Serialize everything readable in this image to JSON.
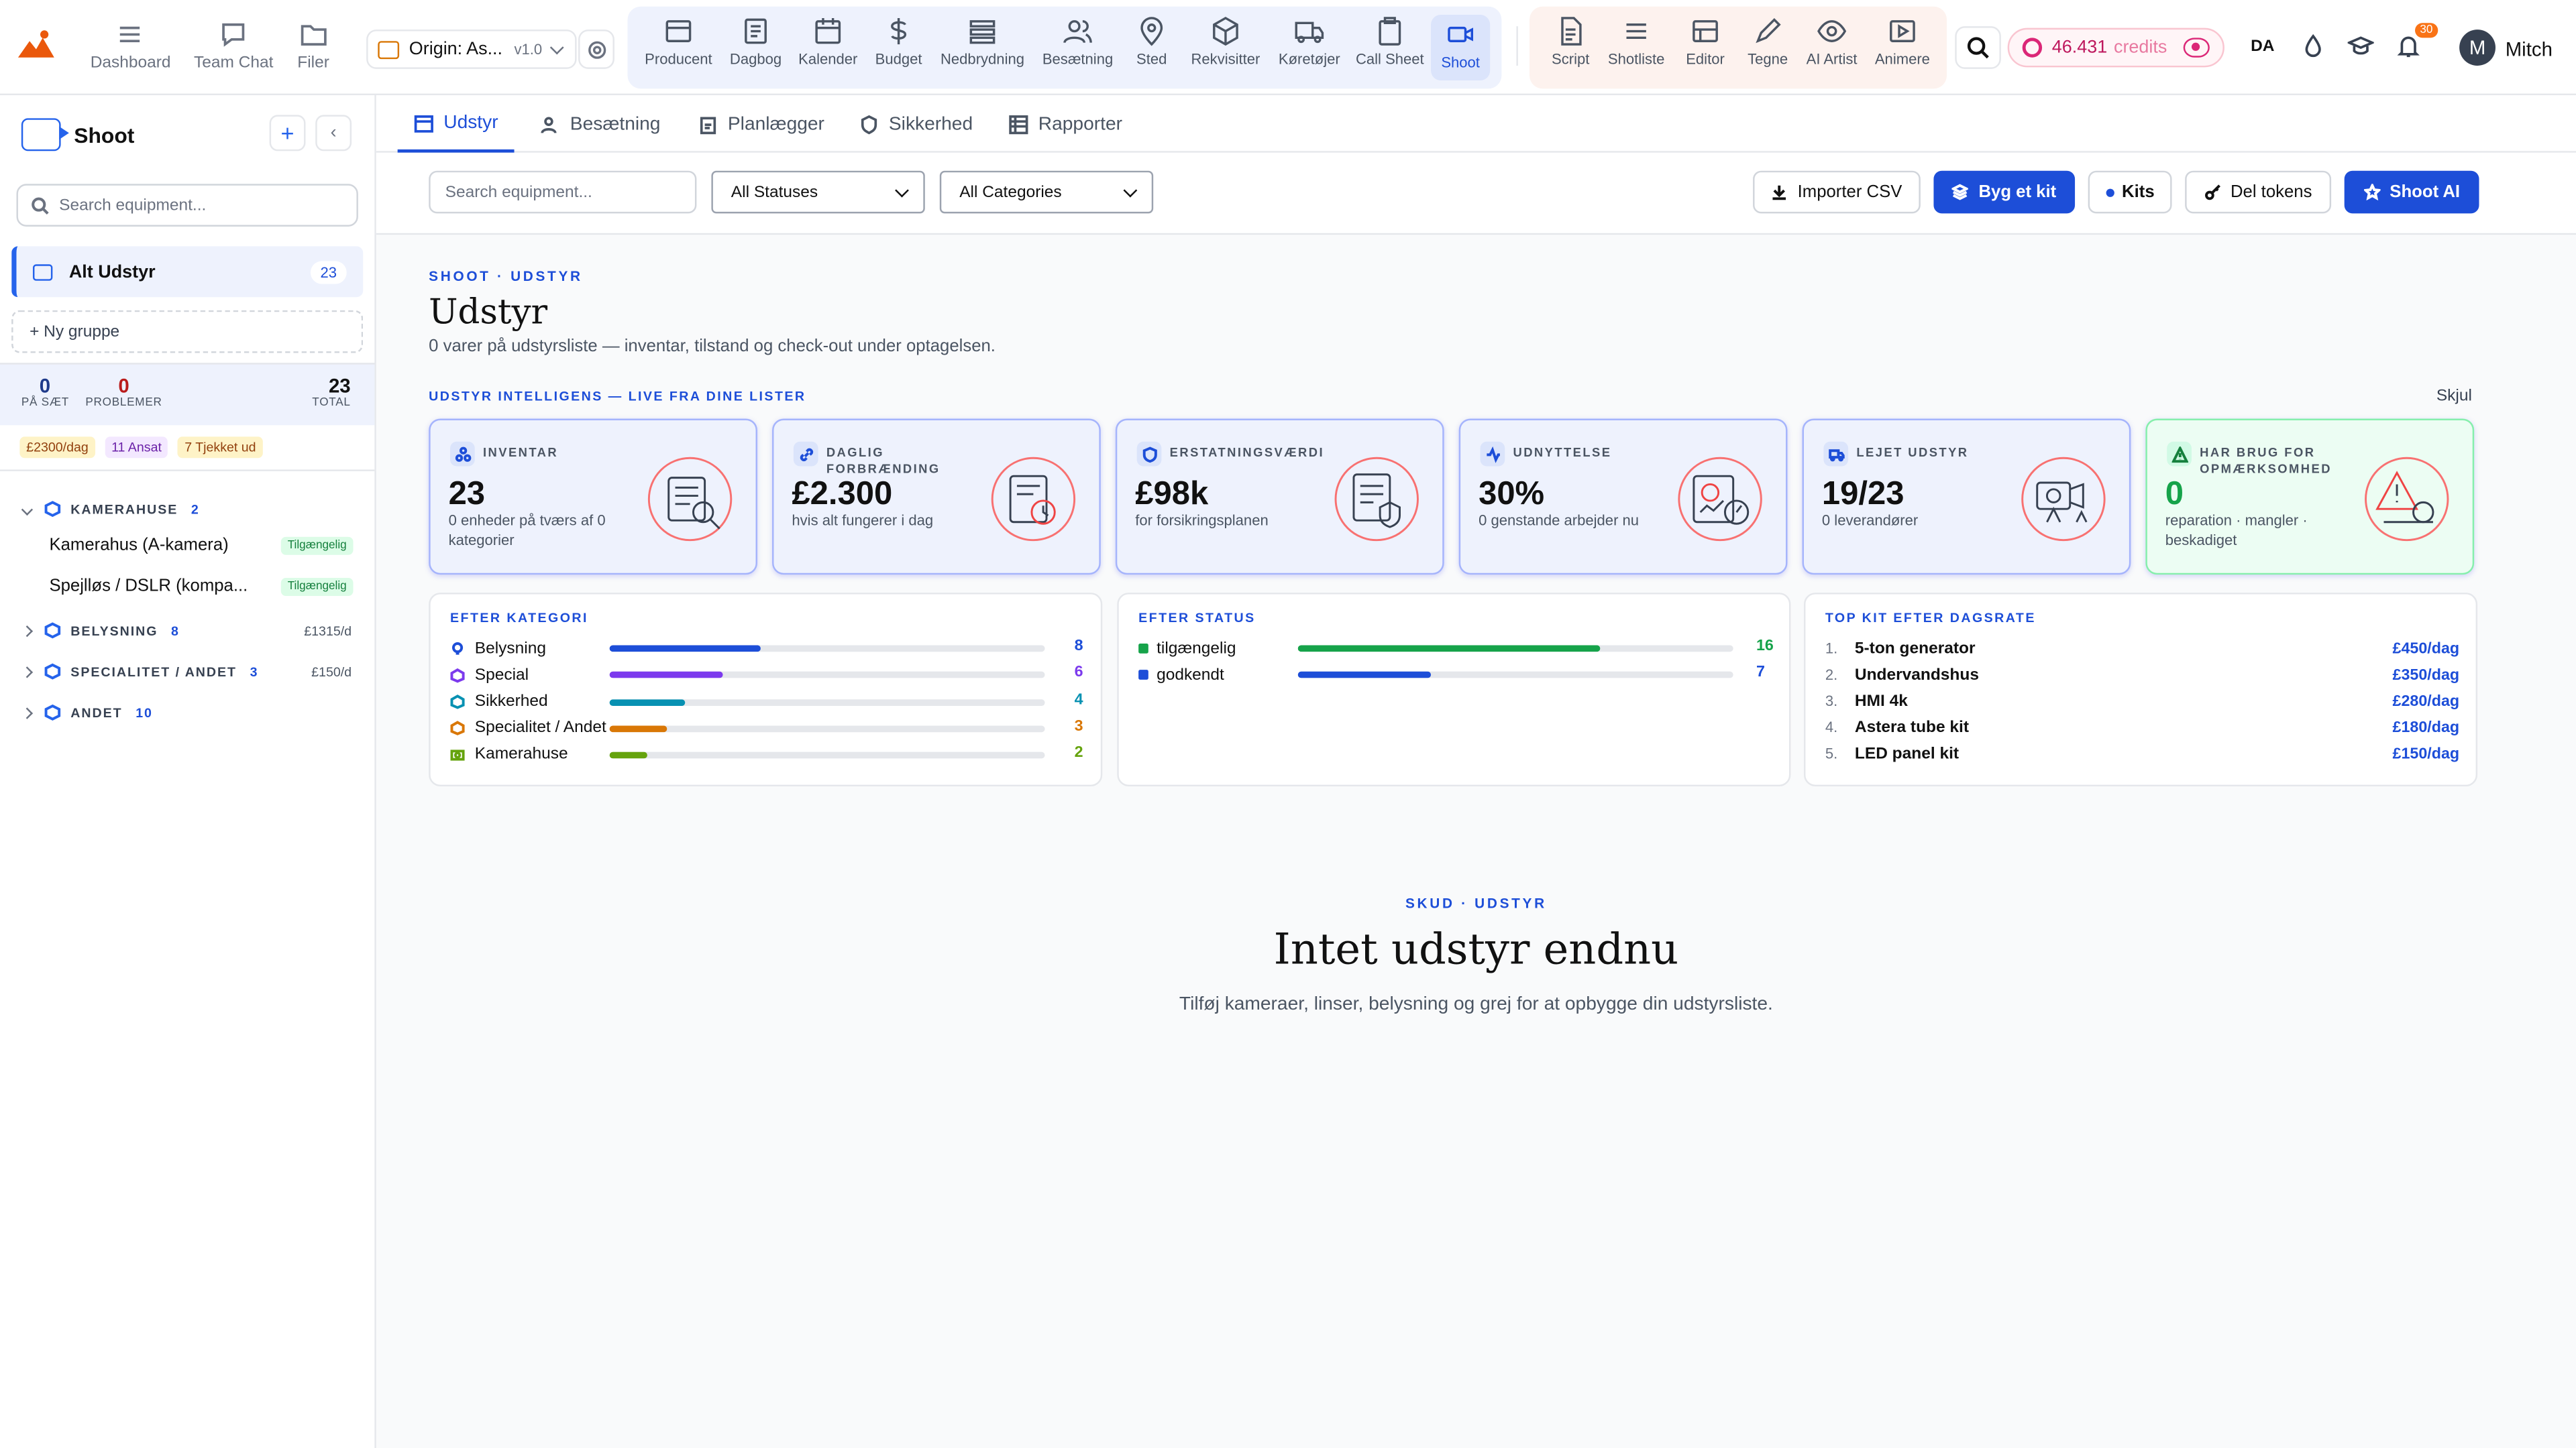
{
  "topnav": {
    "quick": [
      {
        "label": "Dashboard",
        "icon": "menu-icon"
      },
      {
        "label": "Team Chat",
        "icon": "chat-icon"
      },
      {
        "label": "Filer",
        "icon": "folder-icon"
      }
    ],
    "project": {
      "name": "Origin: As...",
      "version": "v1.0"
    },
    "modules": [
      {
        "label": "Producent",
        "icon": "film-icon"
      },
      {
        "label": "Dagbog",
        "icon": "notebook-icon"
      },
      {
        "label": "Kalender",
        "icon": "calendar-icon"
      },
      {
        "label": "Budget",
        "icon": "dollar-icon"
      },
      {
        "label": "Nedbrydning",
        "icon": "list-icon"
      },
      {
        "label": "Besætning",
        "icon": "people-icon"
      },
      {
        "label": "Sted",
        "icon": "map-pin-icon"
      },
      {
        "label": "Rekvisitter",
        "icon": "cube-icon"
      },
      {
        "label": "Køretøjer",
        "icon": "truck-icon"
      },
      {
        "label": "Call Sheet",
        "icon": "clipboard-icon"
      },
      {
        "label": "Shoot",
        "icon": "video-icon"
      }
    ],
    "creative": [
      {
        "label": "Script",
        "icon": "document-icon"
      },
      {
        "label": "Shotliste",
        "icon": "lines-icon"
      },
      {
        "label": "Editor",
        "icon": "editor-icon"
      },
      {
        "label": "Tegne",
        "icon": "pencil-icon"
      },
      {
        "label": "AI Artist",
        "icon": "eye-icon"
      },
      {
        "label": "Animere",
        "icon": "play-icon"
      }
    ],
    "credits_value": "46.431",
    "credits_label": "credits",
    "language": "DA",
    "notifications": "30",
    "user_initial": "M",
    "user_name": "Mitch"
  },
  "sidebar": {
    "title": "Shoot",
    "search_placeholder": "Search equipment...",
    "all_group": {
      "label": "Alt Udstyr",
      "count": "23"
    },
    "new_group": "+ Ny gruppe",
    "stats": [
      {
        "value": "0",
        "label": "PÅ SÆT"
      },
      {
        "value": "0",
        "label": "PROBLEMER"
      },
      {
        "value": "23",
        "label": "TOTAL"
      }
    ],
    "chips": [
      "£2300/dag",
      "11 Ansat",
      "7 Tjekket ud"
    ],
    "groups": [
      {
        "name": "KAMERAHUSE",
        "count": "2",
        "rate": ""
      },
      {
        "name": "BELYSNING",
        "count": "8",
        "rate": "£1315/d"
      },
      {
        "name": "SPECIALITET / ANDET",
        "count": "3",
        "rate": "£150/d"
      },
      {
        "name": "ANDET",
        "count": "10",
        "rate": ""
      }
    ],
    "items": [
      {
        "name": "Kamerahus (A-kamera)",
        "status": "Tilgængelig"
      },
      {
        "name": "Spejlløs / DSLR (kompa...",
        "status": "Tilgængelig"
      }
    ]
  },
  "tabs": [
    "Udstyr",
    "Besætning",
    "Planlægger",
    "Sikkerhed",
    "Rapporter"
  ],
  "toolbar": {
    "search_placeholder": "Search equipment...",
    "status_filter": "All Statuses",
    "category_filter": "All Categories",
    "import": "Importer CSV",
    "build_kit": "Byg et kit",
    "kits": "Kits",
    "share_tokens": "Del tokens",
    "shoot_ai": "Shoot AI"
  },
  "header": {
    "eyebrow": "SHOOT · UDSTYR",
    "title": "Udstyr",
    "subtitle": "0 varer på udstyrsliste — inventar, tilstand og check-out under optagelsen."
  },
  "intel": {
    "title": "UDSTYR INTELLIGENS — LIVE FRA DINE LISTER",
    "hide": "Skjul",
    "cards": [
      {
        "label": "INVENTAR",
        "value": "23",
        "desc": "0 enheder på tværs af 0 kategorier"
      },
      {
        "label": "DAGLIG FORBRÆNDING",
        "value": "£2.300",
        "desc": "hvis alt fungerer i dag"
      },
      {
        "label": "ERSTATNINGSVÆRDI",
        "value": "£98k",
        "desc": "for forsikringsplanen"
      },
      {
        "label": "UDNYTTELSE",
        "value": "30%",
        "desc": "0 genstande arbejder nu"
      },
      {
        "label": "LEJET UDSTYR",
        "value": "19/23",
        "desc": "0 leverandører"
      },
      {
        "label": "HAR BRUG FOR OPMÆRKSOMHED",
        "value": "0",
        "desc": "reparation · mangler · beskadiget"
      }
    ]
  },
  "by_category": {
    "title": "EFTER KATEGORI",
    "max": 23,
    "rows": [
      {
        "name": "Belysning",
        "value": 8,
        "color": "#1d4ed8"
      },
      {
        "name": "Special",
        "value": 6,
        "color": "#7c3aed"
      },
      {
        "name": "Sikkerhed",
        "value": 4,
        "color": "#0891b2"
      },
      {
        "name": "Specialitet / Andet",
        "value": 3,
        "color": "#d97706"
      },
      {
        "name": "Kamerahuse",
        "value": 2,
        "color": "#65a30d"
      }
    ]
  },
  "by_status": {
    "title": "EFTER STATUS",
    "max": 23,
    "rows": [
      {
        "name": "tilgængelig",
        "value": 16,
        "color": "#16a34a"
      },
      {
        "name": "godkendt",
        "value": 7,
        "color": "#1d4ed8"
      }
    ]
  },
  "top_kits": {
    "title": "TOP KIT EFTER DAGSRATE",
    "rows": [
      {
        "num": "1.",
        "name": "5-ton generator",
        "rate": "£450/dag"
      },
      {
        "num": "2.",
        "name": "Undervandshus",
        "rate": "£350/dag"
      },
      {
        "num": "3.",
        "name": "HMI 4k",
        "rate": "£280/dag"
      },
      {
        "num": "4.",
        "name": "Astera tube kit",
        "rate": "£180/dag"
      },
      {
        "num": "5.",
        "name": "LED panel kit",
        "rate": "£150/dag"
      }
    ]
  },
  "empty": {
    "eyebrow": "SKUD · UDSTYR",
    "title": "Intet udstyr endnu",
    "subtitle": "Tilføj kameraer, linser, belysning og grej for at opbygge din udstyrsliste."
  }
}
